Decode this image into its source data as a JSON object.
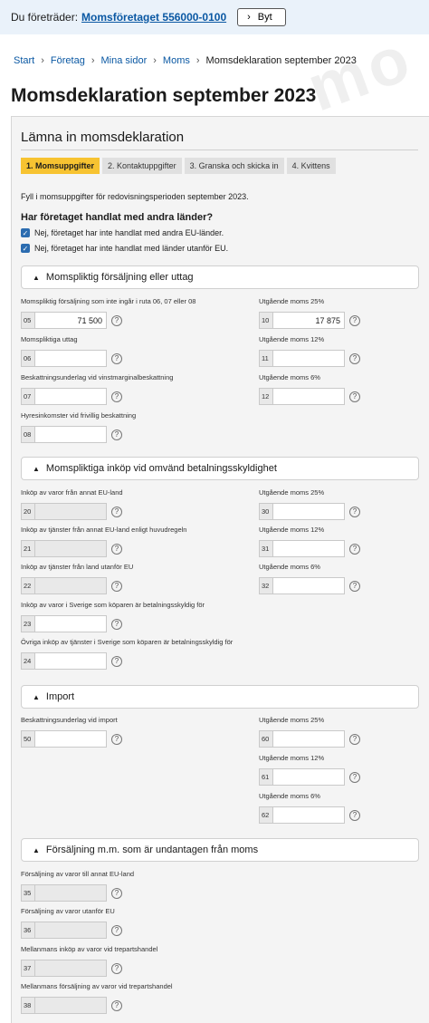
{
  "topbar": {
    "label": "Du företräder:",
    "company": "Momsföretaget 556000-0100",
    "switch_label": "Byt"
  },
  "watermark": "mo",
  "breadcrumb": {
    "items": [
      "Start",
      "Företag",
      "Mina sidor",
      "Moms"
    ],
    "current": "Momsdeklaration september 2023"
  },
  "page_title": "Momsdeklaration september 2023",
  "form": {
    "title": "Lämna in momsdeklaration",
    "steps": [
      "1. Momsuppgifter",
      "2. Kontaktuppgifter",
      "3. Granska och skicka in",
      "4. Kvittens"
    ],
    "intro": "Fyll i momsuppgifter för redovisningsperioden september 2023.",
    "question": "Har företaget handlat med andra länder?",
    "checkboxes": [
      "Nej, företaget har inte handlat med andra EU-länder.",
      "Nej, företaget har inte handlat med länder utanför EU."
    ]
  },
  "sections": [
    {
      "title": "Momspliktig försäljning eller uttag"
    },
    {
      "title": "Momspliktiga inköp vid omvänd betalningsskyldighet"
    },
    {
      "title": "Import"
    },
    {
      "title": "Försäljning m.m. som är undantagen från moms"
    }
  ],
  "fields": {
    "f05": {
      "label": "Momspliktig försäljning som inte ingår i ruta 06, 07 eller 08",
      "code": "05",
      "value": "71 500"
    },
    "f10": {
      "label": "Utgående moms 25%",
      "code": "10",
      "value": "17 875"
    },
    "f06": {
      "label": "Momspliktiga uttag",
      "code": "06",
      "value": ""
    },
    "f11": {
      "label": "Utgående moms 12%",
      "code": "11",
      "value": ""
    },
    "f07": {
      "label": "Beskattningsunderlag vid vinstmarginalbeskattning",
      "code": "07",
      "value": ""
    },
    "f12": {
      "label": "Utgående moms 6%",
      "code": "12",
      "value": ""
    },
    "f08": {
      "label": "Hyresinkomster vid frivillig beskattning",
      "code": "08",
      "value": ""
    },
    "f20": {
      "label": "Inköp av varor från annat EU-land",
      "code": "20",
      "value": ""
    },
    "f30": {
      "label": "Utgående moms 25%",
      "code": "30",
      "value": ""
    },
    "f21": {
      "label": "Inköp av tjänster från annat EU-land enligt huvudregeln",
      "code": "21",
      "value": ""
    },
    "f31": {
      "label": "Utgående moms 12%",
      "code": "31",
      "value": ""
    },
    "f22": {
      "label": "Inköp av tjänster från land utanför EU",
      "code": "22",
      "value": ""
    },
    "f32": {
      "label": "Utgående moms 6%",
      "code": "32",
      "value": ""
    },
    "f23": {
      "label": "Inköp av varor i Sverige som köparen är betalningsskyldig för",
      "code": "23",
      "value": ""
    },
    "f24": {
      "label": "Övriga inköp av tjänster i Sverige som köparen är betalningsskyldig för",
      "code": "24",
      "value": ""
    },
    "f50": {
      "label": "Beskattningsunderlag vid import",
      "code": "50",
      "value": ""
    },
    "f60": {
      "label": "Utgående moms 25%",
      "code": "60",
      "value": ""
    },
    "f61": {
      "label": "Utgående moms 12%",
      "code": "61",
      "value": ""
    },
    "f62": {
      "label": "Utgående moms 6%",
      "code": "62",
      "value": ""
    },
    "f35": {
      "label": "Försäljning av varor till annat EU-land",
      "code": "35",
      "value": ""
    },
    "f36": {
      "label": "Försäljning av varor utanför EU",
      "code": "36",
      "value": ""
    },
    "f37": {
      "label": "Mellanmans inköp av varor vid trepartshandel",
      "code": "37",
      "value": ""
    },
    "f38": {
      "label": "Mellanmans försäljning av varor vid trepartshandel",
      "code": "38",
      "value": ""
    }
  },
  "help_glyph": "?"
}
